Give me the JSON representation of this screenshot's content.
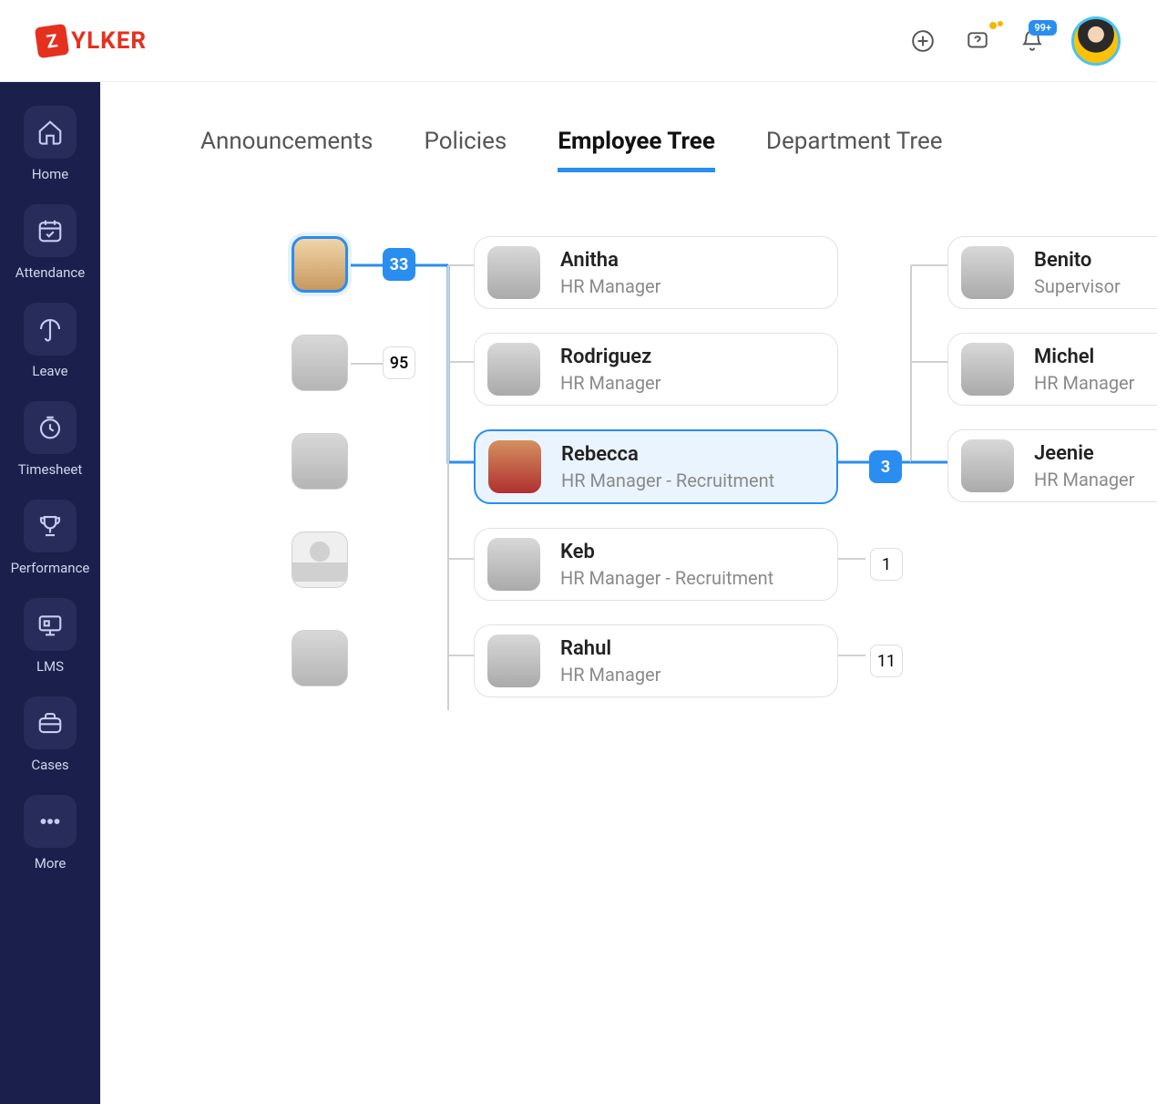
{
  "brand": {
    "letter": "Z",
    "name": "YLKER"
  },
  "topbar": {
    "notif_badge": "99+"
  },
  "sidebar": {
    "items": [
      {
        "label": "Home"
      },
      {
        "label": "Attendance"
      },
      {
        "label": "Leave"
      },
      {
        "label": "Timesheet"
      },
      {
        "label": "Performance"
      },
      {
        "label": "LMS"
      },
      {
        "label": "Cases"
      },
      {
        "label": "More"
      }
    ]
  },
  "tabs": {
    "announcements": "Announcements",
    "policies": "Policies",
    "employee_tree": "Employee Tree",
    "department_tree": "Department Tree"
  },
  "roots": {
    "r0_count": "33",
    "r1_count": "95"
  },
  "mid": {
    "anitha": {
      "name": "Anitha",
      "title": "HR Manager"
    },
    "rodriguez": {
      "name": "Rodriguez",
      "title": "HR Manager"
    },
    "rebecca": {
      "name": "Rebecca",
      "title": "HR Manager - Recruitment",
      "count": "3"
    },
    "keb": {
      "name": "Keb",
      "title": "HR Manager - Recruitment",
      "count": "1"
    },
    "rahul": {
      "name": "Rahul",
      "title": "HR Manager",
      "count": "11"
    }
  },
  "right": {
    "benito": {
      "name": "Benito",
      "title": "Supervisor"
    },
    "michel": {
      "name": "Michel",
      "title": "HR Manager"
    },
    "jeenie": {
      "name": "Jeenie",
      "title": "HR Manager"
    }
  }
}
